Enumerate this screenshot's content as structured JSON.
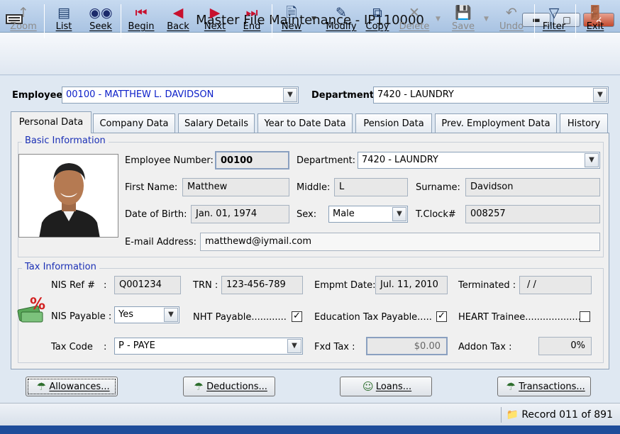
{
  "window": {
    "title": "Master File Maintenance - IP110000"
  },
  "toolbar": {
    "zoom": "Zoom",
    "list": "List",
    "seek": "Seek",
    "begin": "Begin",
    "back": "Back",
    "next": "Next",
    "end": "End",
    "new": "New",
    "modify": "Modify",
    "copy": "Copy",
    "delete": "Delete",
    "save": "Save",
    "undo": "Undo",
    "filter": "Filter",
    "exit": "Exit"
  },
  "header": {
    "employee_label": "Employee:",
    "employee_value": "00100 - MATTHEW L. DAVIDSON",
    "department_label": "Department:",
    "department_value": "7420  - LAUNDRY"
  },
  "tabs": [
    {
      "label": "Personal Data"
    },
    {
      "label": "Company Data"
    },
    {
      "label": "Salary Details"
    },
    {
      "label": "Year to Date Data"
    },
    {
      "label": "Pension Data"
    },
    {
      "label": "Prev. Employment Data"
    },
    {
      "label": "History"
    }
  ],
  "basic": {
    "title": "Basic Information",
    "employee_number_label": "Employee Number:",
    "employee_number": "00100",
    "department_label": "Department:",
    "department": "7420 - LAUNDRY",
    "first_name_label": "First Name:",
    "first_name": "Matthew",
    "middle_label": "Middle:",
    "middle": "L",
    "surname_label": "Surname:",
    "surname": "Davidson",
    "dob_label": "Date of Birth:",
    "dob": "Jan. 01, 1974",
    "sex_label": "Sex:",
    "sex": "Male",
    "tclock_label": "T.Clock#",
    "tclock": "008257",
    "email_label": "E-mail Address:",
    "email": "matthewd@iymail.com"
  },
  "tax": {
    "title": "Tax Information",
    "nis_ref_label": "NIS Ref #",
    "nis_ref_colon": ":",
    "nis_ref": "Q001234",
    "trn_label": "TRN :",
    "trn": "123-456-789",
    "empmt_date_label": "Empmt Date:",
    "empmt_date": "Jul. 11, 2010",
    "terminated_label": "Terminated :",
    "terminated": "/ /",
    "nis_payable_label": "NIS Payable :",
    "nis_payable": "Yes",
    "nht_label": "NHT Payable............",
    "nht_checked": true,
    "edu_label": "Education Tax Payable.....",
    "edu_checked": true,
    "heart_label": "HEART Trainee...................",
    "heart_checked": false,
    "tax_code_label": "Tax Code",
    "tax_code_colon": ":",
    "tax_code": "P - PAYE",
    "fxd_tax_label": "Fxd Tax :",
    "fxd_tax": "$0.00",
    "addon_tax_label": "Addon Tax :",
    "addon_tax": "0%"
  },
  "buttons": {
    "allowances": "Allowances...",
    "deductions": "Deductions...",
    "loans": "Loans...",
    "transactions": "Transactions..."
  },
  "status": {
    "record": "Record 011 of 891"
  },
  "icons": {
    "checkmark": "✓"
  },
  "colors": {
    "accent_blue": "#0d20c9",
    "group_title": "#1a2fb5",
    "nav_red": "#c8102e"
  }
}
